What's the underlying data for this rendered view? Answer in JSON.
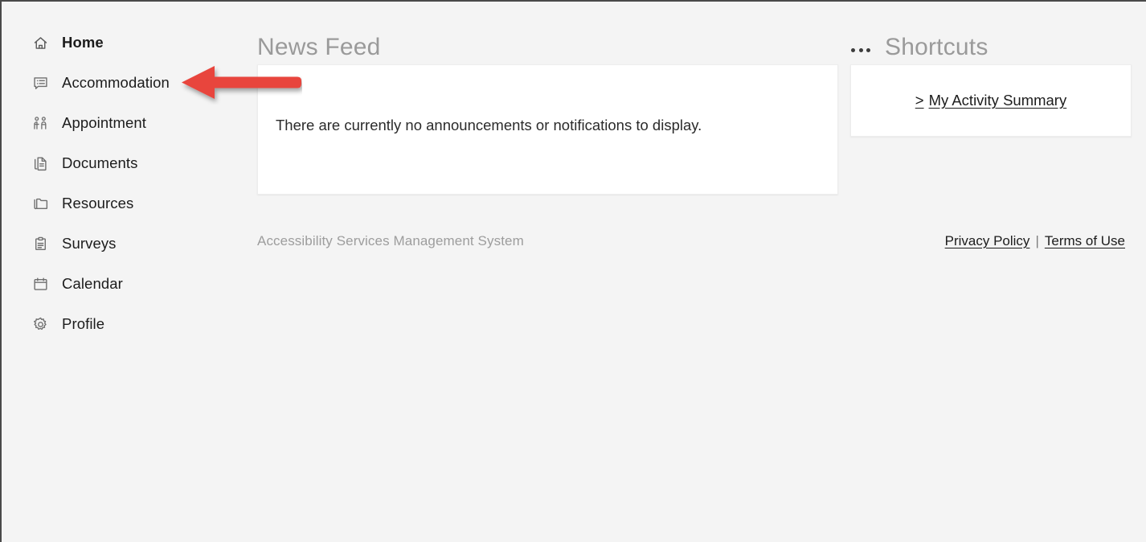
{
  "sidebar": {
    "items": [
      {
        "label": "Home",
        "icon": "home-icon",
        "active": true
      },
      {
        "label": "Accommodation",
        "icon": "message-list-icon",
        "active": false
      },
      {
        "label": "Appointment",
        "icon": "people-icon",
        "active": false
      },
      {
        "label": "Documents",
        "icon": "documents-icon",
        "active": false
      },
      {
        "label": "Resources",
        "icon": "folder-icon",
        "active": false
      },
      {
        "label": "Surveys",
        "icon": "clipboard-icon",
        "active": false
      },
      {
        "label": "Calendar",
        "icon": "calendar-icon",
        "active": false
      },
      {
        "label": "Profile",
        "icon": "gear-icon",
        "active": false
      }
    ]
  },
  "news_feed": {
    "title": "News Feed",
    "empty_message": "There are currently no announcements or notifications to display."
  },
  "shortcuts": {
    "title": "Shortcuts",
    "menu_icon": "kebab-menu-icon",
    "links": [
      {
        "chevron": ">",
        "label": "My Activity Summary"
      }
    ]
  },
  "footer": {
    "brand": "Accessibility Services Management System",
    "privacy_policy": "Privacy Policy",
    "separator": "|",
    "terms_of_use": "Terms of Use"
  },
  "annotation": {
    "type": "arrow",
    "direction": "left",
    "color": "#E8453C",
    "points_at": "Accommodation"
  }
}
